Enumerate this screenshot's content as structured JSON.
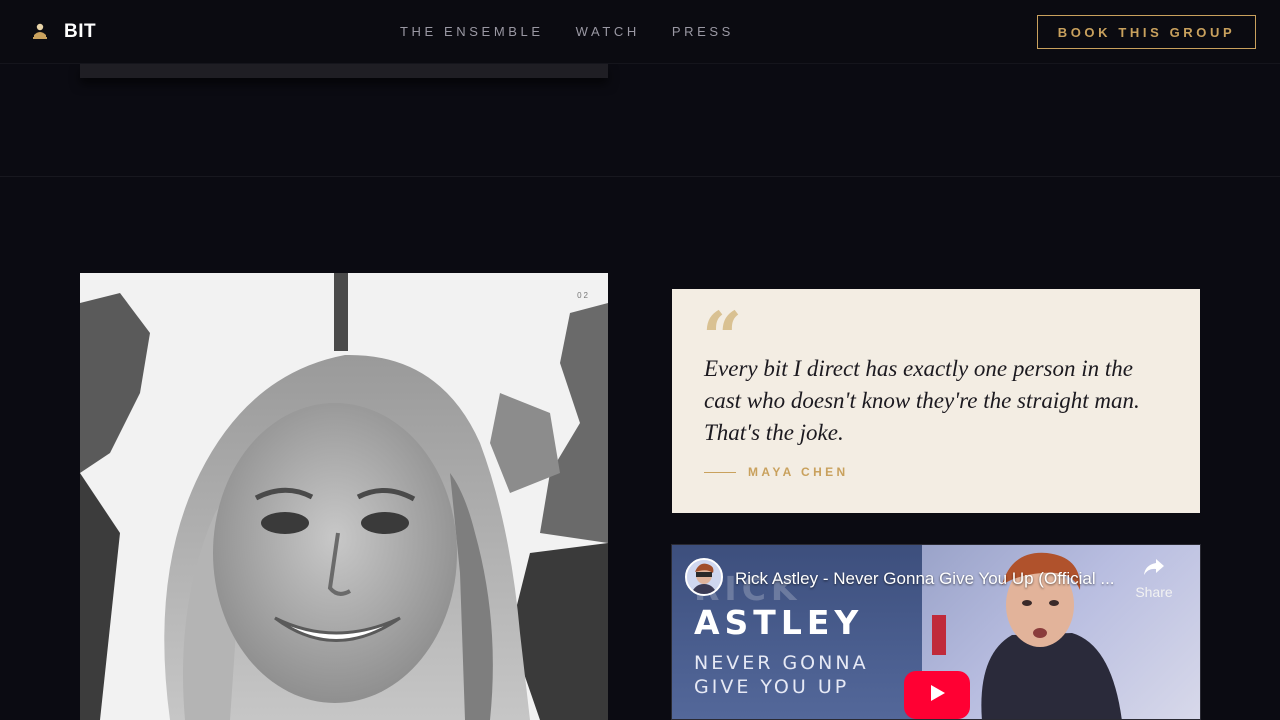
{
  "nav": {
    "brand": "BIT",
    "links": [
      "THE ENSEMBLE",
      "WATCH",
      "PRESS"
    ],
    "cta": "BOOK THIS GROUP"
  },
  "portrait": {
    "index": "02"
  },
  "quote": {
    "mark": "“",
    "text": "Every bit I direct has exactly one person in the cast who doesn't know they're the straight man. That's the joke.",
    "author": "MAYA CHEN"
  },
  "video": {
    "title": "Rick Astley - Never Gonna Give You Up (Official ...",
    "share_label": "Share",
    "thumb_line1": "RICK",
    "thumb_line2": "ASTLEY",
    "thumb_line3": "NEVER GONNA",
    "thumb_line4": "GIVE YOU UP"
  },
  "colors": {
    "background": "#0b0b12",
    "accent_gold": "#c9a15d",
    "quote_card": "#f3ede3",
    "youtube_red": "#ff0033"
  },
  "icons": [
    "logo-figure-icon",
    "quote-mark-icon",
    "share-icon",
    "play-icon"
  ]
}
